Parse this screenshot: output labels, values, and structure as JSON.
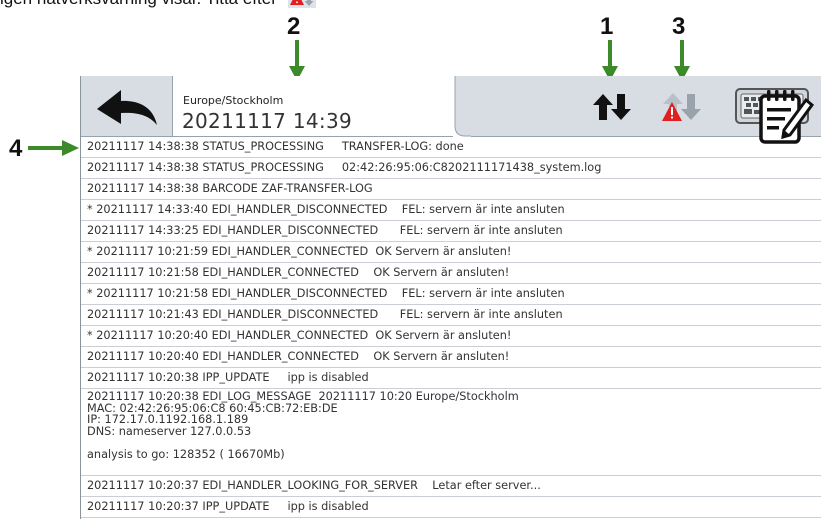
{
  "caption": {
    "text": "igen nätverksvarning visar. Titta efter"
  },
  "callouts": [
    {
      "number": "1"
    },
    {
      "number": "2"
    },
    {
      "number": "3"
    },
    {
      "number": "4"
    }
  ],
  "header": {
    "timezone": "Europe/Stockholm",
    "datetime": "20211117 14:39",
    "icons": [
      "back-arrow-icon",
      "transfer-arrows-icon",
      "network-warning-icon",
      "keyboard-icon"
    ]
  },
  "log_rows": [
    {
      "text": "20211117 14:38:38 STATUS_PROCESSING     TRANSFER-LOG: done"
    },
    {
      "text": "20211117 14:38:38 STATUS_PROCESSING     02:42:26:95:06:C8202111171438_system.log"
    },
    {
      "text": "20211117 14:38:38 BARCODE ZAF-TRANSFER-LOG"
    },
    {
      "text": "* 20211117 14:33:40 EDI_HANDLER_DISCONNECTED    FEL: servern är inte ansluten"
    },
    {
      "text": "20211117 14:33:25 EDI_HANDLER_DISCONNECTED      FEL: servern är inte ansluten"
    },
    {
      "text": "* 20211117 10:21:59 EDI_HANDLER_CONNECTED  OK Servern är ansluten!"
    },
    {
      "text": "20211117 10:21:58 EDI_HANDLER_CONNECTED    OK Servern är ansluten!"
    },
    {
      "text": "* 20211117 10:21:58 EDI_HANDLER_DISCONNECTED    FEL: servern är inte ansluten"
    },
    {
      "text": "20211117 10:21:43 EDI_HANDLER_DISCONNECTED      FEL: servern är inte ansluten"
    },
    {
      "text": "* 20211117 10:20:40 EDI_HANDLER_CONNECTED  OK Servern är ansluten!"
    },
    {
      "text": "20211117 10:20:40 EDI_HANDLER_CONNECTED    OK Servern är ansluten!"
    },
    {
      "text": "20211117 10:20:38 IPP_UPDATE     ipp is disabled"
    },
    {
      "text": "20211117 10:20:38 EDI_LOG_MESSAGE  20211117 10:20 Europe/Stockholm\nMAC: 02:42:26:95:06:C8 60:45:CB:72:EB:DE\nIP: 172.17.0.1192.168.1.189\nDNS: nameserver 127.0.0.53\n\nanalysis to go: 128352 ( 16670Mb)"
    },
    {
      "text": "20211117 10:20:37 EDI_HANDLER_LOOKING_FOR_SERVER    Letar efter server..."
    },
    {
      "text": "20211117 10:20:37 IPP_UPDATE     ipp is disabled"
    }
  ],
  "colors": {
    "header_bg": "#d7dde3",
    "callout_arrow": "#3d8a2a",
    "warning_red": "#e02020",
    "icon_dark": "#111111",
    "icon_grey": "#9aa3ab"
  }
}
